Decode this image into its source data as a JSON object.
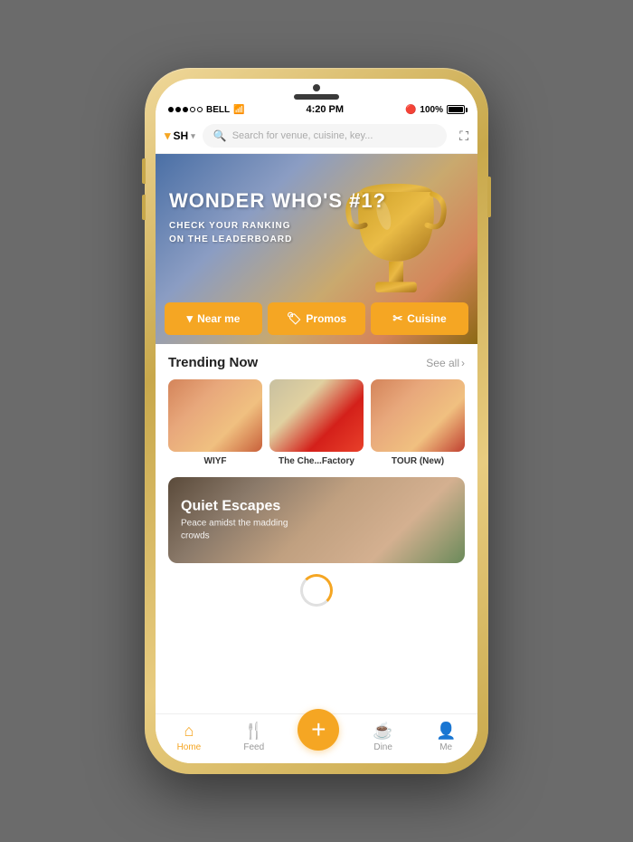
{
  "phone": {
    "status_bar": {
      "carrier": "BELL",
      "wifi_icon": "wifi",
      "time": "4:20 PM",
      "bluetooth_icon": "bluetooth",
      "battery_percent": "100%",
      "battery_icon": "battery"
    },
    "search_bar": {
      "location_code": "SH",
      "placeholder": "Search for venue, cuisine, key...",
      "expand_icon": "expand"
    },
    "hero": {
      "title_line1": "WONDER WHO'S #1?",
      "subtitle_line1": "CHECK YOUR RANKING",
      "subtitle_line2": "ON THE LEADERBOARD",
      "btn_near_me": "Near me",
      "btn_promos": "Promos",
      "btn_cuisine": "Cuisine"
    },
    "trending": {
      "section_title": "Trending Now",
      "see_all": "See all",
      "items": [
        {
          "name": "WIYF"
        },
        {
          "name": "The Che...Factory"
        },
        {
          "name": "TOUR (New)"
        }
      ]
    },
    "feature_banner": {
      "title": "Quiet Escapes",
      "subtitle": "Peace amidst the madding\ncrowds"
    },
    "nav": {
      "home": "Home",
      "feed": "Feed",
      "add": "+",
      "dine": "Dine",
      "me": "Me"
    }
  }
}
